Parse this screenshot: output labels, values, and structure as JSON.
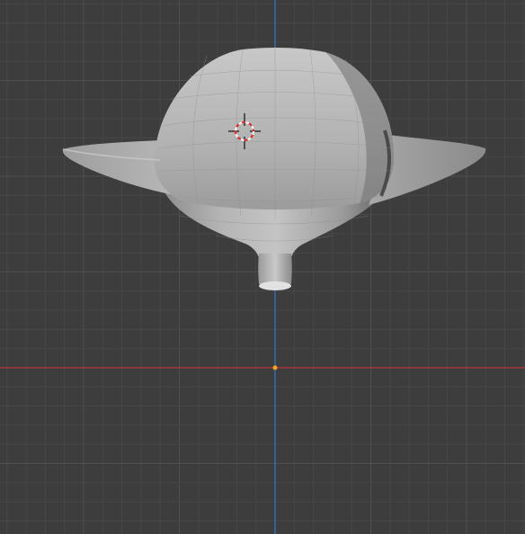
{
  "viewport": {
    "background_color": "#3d3d3d",
    "grid_minor_color": "#474747",
    "grid_major_color": "#4f4f4f",
    "axis_x_color": "#b8333f",
    "axis_z_color": "#2f74c0",
    "origin_color": "#f5a623"
  },
  "object": {
    "shape": "vase-like mesh with flared rim and narrow spout",
    "shade_light": "#d3d3d3",
    "shade_mid": "#a8a8a8",
    "shade_dark": "#6e6e6e"
  },
  "cursor_3d": {
    "icon": "crosshair-icon",
    "ring_colors": [
      "#d8322e",
      "#f2f2f2"
    ]
  }
}
